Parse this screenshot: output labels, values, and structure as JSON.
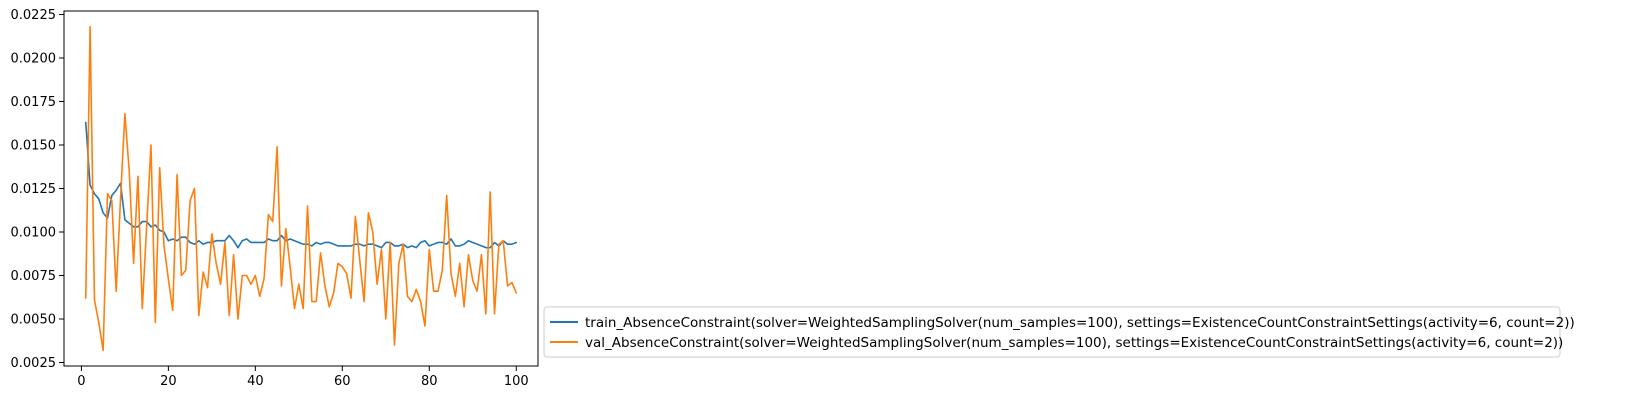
{
  "chart_data": {
    "type": "line",
    "title": "",
    "xlabel": "",
    "ylabel": "",
    "xlim": [
      -4,
      105
    ],
    "ylim": [
      0.0023,
      0.0227
    ],
    "x_ticks": [
      0,
      20,
      40,
      60,
      80,
      100
    ],
    "x_tick_labels": [
      "0",
      "20",
      "40",
      "60",
      "80",
      "100"
    ],
    "y_ticks": [
      0.0025,
      0.005,
      0.0075,
      0.01,
      0.0125,
      0.015,
      0.0175,
      0.02,
      0.0225
    ],
    "y_tick_labels": [
      "0.0025",
      "0.0050",
      "0.0075",
      "0.0100",
      "0.0125",
      "0.0150",
      "0.0175",
      "0.0200",
      "0.0225"
    ],
    "legend_placement": "outside right, bottom",
    "x": [
      1,
      2,
      3,
      4,
      5,
      6,
      7,
      8,
      9,
      10,
      11,
      12,
      13,
      14,
      15,
      16,
      17,
      18,
      19,
      20,
      21,
      22,
      23,
      24,
      25,
      26,
      27,
      28,
      29,
      30,
      31,
      32,
      33,
      34,
      35,
      36,
      37,
      38,
      39,
      40,
      41,
      42,
      43,
      44,
      45,
      46,
      47,
      48,
      49,
      50,
      51,
      52,
      53,
      54,
      55,
      56,
      57,
      58,
      59,
      60,
      61,
      62,
      63,
      64,
      65,
      66,
      67,
      68,
      69,
      70,
      71,
      72,
      73,
      74,
      75,
      76,
      77,
      78,
      79,
      80,
      81,
      82,
      83,
      84,
      85,
      86,
      87,
      88,
      89,
      90,
      91,
      92,
      93,
      94,
      95,
      96,
      97,
      98,
      99,
      100
    ],
    "series": [
      {
        "name": "train_AbsenceConstraint(solver=WeightedSamplingSolver(num_samples=100), settings=ExistenceCountConstraintSettings(activity=6, count=2))",
        "color": "#1f77b4",
        "values": [
          0.0163,
          0.0127,
          0.0122,
          0.0119,
          0.0111,
          0.0108,
          0.0121,
          0.0124,
          0.0128,
          0.0107,
          0.0105,
          0.0103,
          0.0103,
          0.0106,
          0.0106,
          0.0103,
          0.0104,
          0.0101,
          0.01,
          0.0095,
          0.0096,
          0.0095,
          0.0097,
          0.0097,
          0.0094,
          0.0093,
          0.0095,
          0.0093,
          0.0094,
          0.0094,
          0.0095,
          0.0095,
          0.0095,
          0.0098,
          0.0095,
          0.0091,
          0.0095,
          0.0096,
          0.0094,
          0.0094,
          0.0094,
          0.0094,
          0.0096,
          0.0095,
          0.0095,
          0.0098,
          0.0095,
          0.0096,
          0.0095,
          0.0094,
          0.0093,
          0.0093,
          0.0092,
          0.0094,
          0.0093,
          0.0094,
          0.0094,
          0.0093,
          0.0092,
          0.0092,
          0.0092,
          0.0092,
          0.0093,
          0.0093,
          0.0092,
          0.0093,
          0.0093,
          0.0092,
          0.0091,
          0.0094,
          0.0094,
          0.0092,
          0.0092,
          0.0093,
          0.0091,
          0.0092,
          0.0091,
          0.0094,
          0.0095,
          0.0092,
          0.0093,
          0.0094,
          0.0094,
          0.0093,
          0.0096,
          0.0092,
          0.0092,
          0.0093,
          0.0095,
          0.0094,
          0.0093,
          0.0092,
          0.0091,
          0.0091,
          0.0094,
          0.0092,
          0.0095,
          0.0093,
          0.0093,
          0.0094
        ]
      },
      {
        "name": "val_AbsenceConstraint(solver=WeightedSamplingSolver(num_samples=100), settings=ExistenceCountConstraintSettings(activity=6, count=2))",
        "color": "#ff7f0e",
        "values": [
          0.0062,
          0.0218,
          0.0061,
          0.0048,
          0.0032,
          0.0122,
          0.0118,
          0.0066,
          0.0119,
          0.0168,
          0.0135,
          0.0082,
          0.0132,
          0.0056,
          0.0103,
          0.015,
          0.0048,
          0.0137,
          0.0092,
          0.0073,
          0.0055,
          0.0133,
          0.0075,
          0.0078,
          0.0118,
          0.0125,
          0.0052,
          0.0077,
          0.0068,
          0.0099,
          0.0082,
          0.007,
          0.0094,
          0.0052,
          0.0087,
          0.005,
          0.0075,
          0.0075,
          0.007,
          0.0075,
          0.0063,
          0.0073,
          0.011,
          0.0106,
          0.0149,
          0.0069,
          0.0102,
          0.008,
          0.0056,
          0.007,
          0.0056,
          0.0115,
          0.006,
          0.006,
          0.0088,
          0.0069,
          0.0057,
          0.0065,
          0.0082,
          0.008,
          0.0076,
          0.0062,
          0.0109,
          0.0084,
          0.006,
          0.0111,
          0.01,
          0.007,
          0.009,
          0.005,
          0.0094,
          0.0035,
          0.0082,
          0.0093,
          0.0063,
          0.006,
          0.0067,
          0.006,
          0.0046,
          0.009,
          0.0066,
          0.0066,
          0.0078,
          0.0121,
          0.0076,
          0.0063,
          0.0082,
          0.0057,
          0.0087,
          0.0072,
          0.0066,
          0.0087,
          0.0053,
          0.0123,
          0.0053,
          0.0093,
          0.0095,
          0.0069,
          0.0071,
          0.0065
        ]
      }
    ]
  }
}
